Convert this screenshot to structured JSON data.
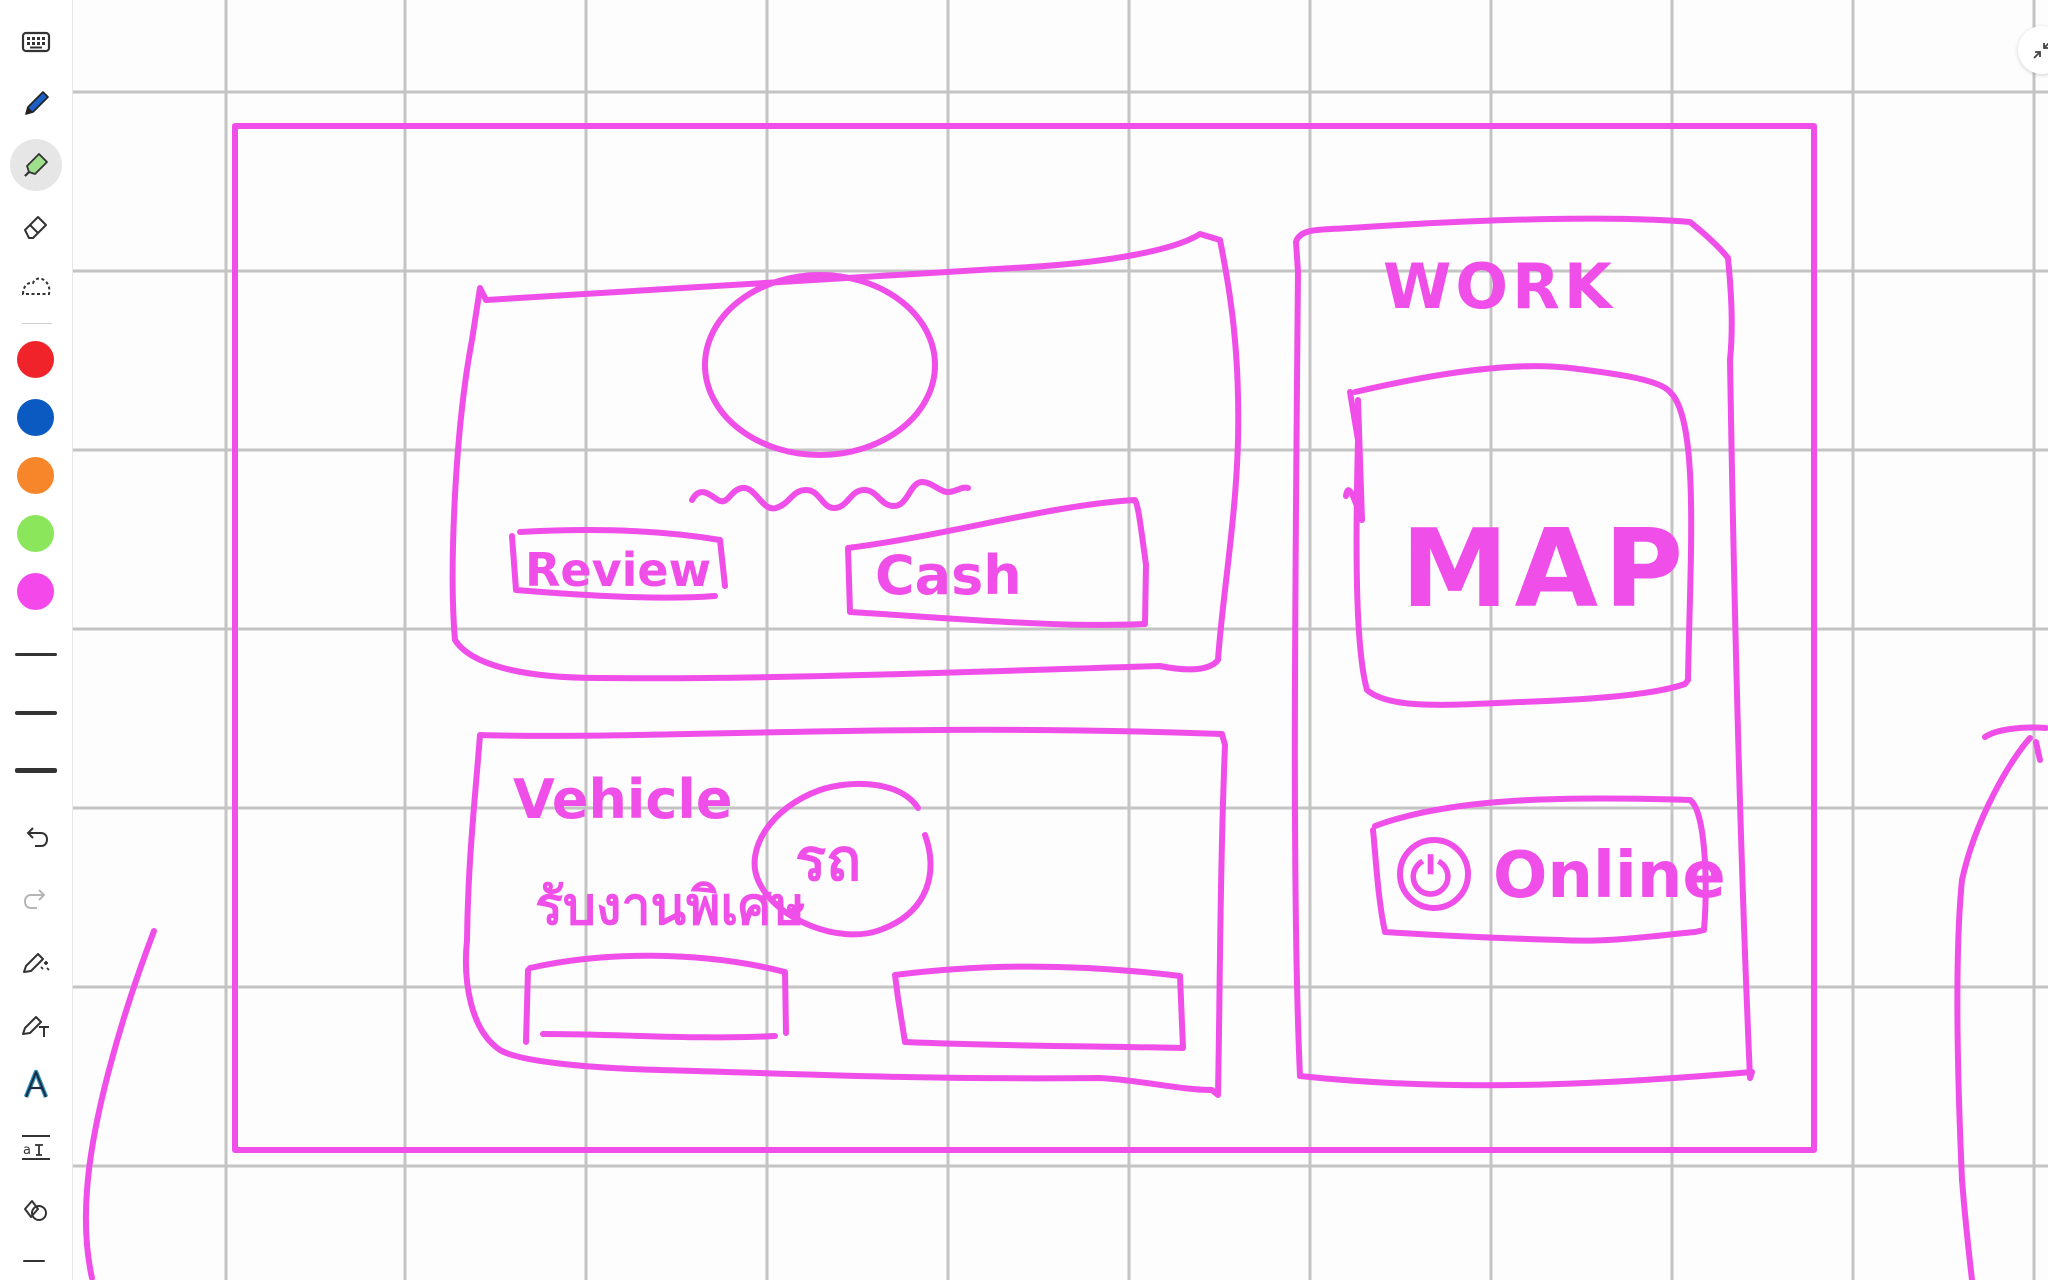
{
  "canvas": {
    "background": "#fdfdfd",
    "grid_color": "#c4c4c4",
    "ink_color": "#f04ee8"
  },
  "toolbar": {
    "tools": [
      {
        "name": "keyboard-icon",
        "selected": false
      },
      {
        "name": "pen-icon",
        "selected": false
      },
      {
        "name": "highlighter-icon",
        "selected": true
      },
      {
        "name": "eraser-icon",
        "selected": false
      },
      {
        "name": "lasso-icon",
        "selected": false
      }
    ],
    "colors": [
      "#f0232a",
      "#0b5ac2",
      "#f7852a",
      "#8ce65c",
      "#f548ea"
    ],
    "stroke_sizes": [
      "thin",
      "medium",
      "thick"
    ],
    "actions": [
      {
        "name": "undo-icon"
      },
      {
        "name": "redo-icon"
      },
      {
        "name": "magic-pen-icon"
      },
      {
        "name": "pen-to-text-icon"
      },
      {
        "name": "text-style-icon"
      },
      {
        "name": "text-size-icon"
      },
      {
        "name": "shapes-icon"
      }
    ]
  },
  "sketch": {
    "texts": {
      "work": "WORK",
      "map": "MAP",
      "review": "Review",
      "cash": "Cash",
      "vehicle": "Vehicle",
      "thai_left": "รับงานพิเศษ",
      "thai_circle": "รถ",
      "online": "Online",
      "online_icon": "⏻"
    }
  }
}
